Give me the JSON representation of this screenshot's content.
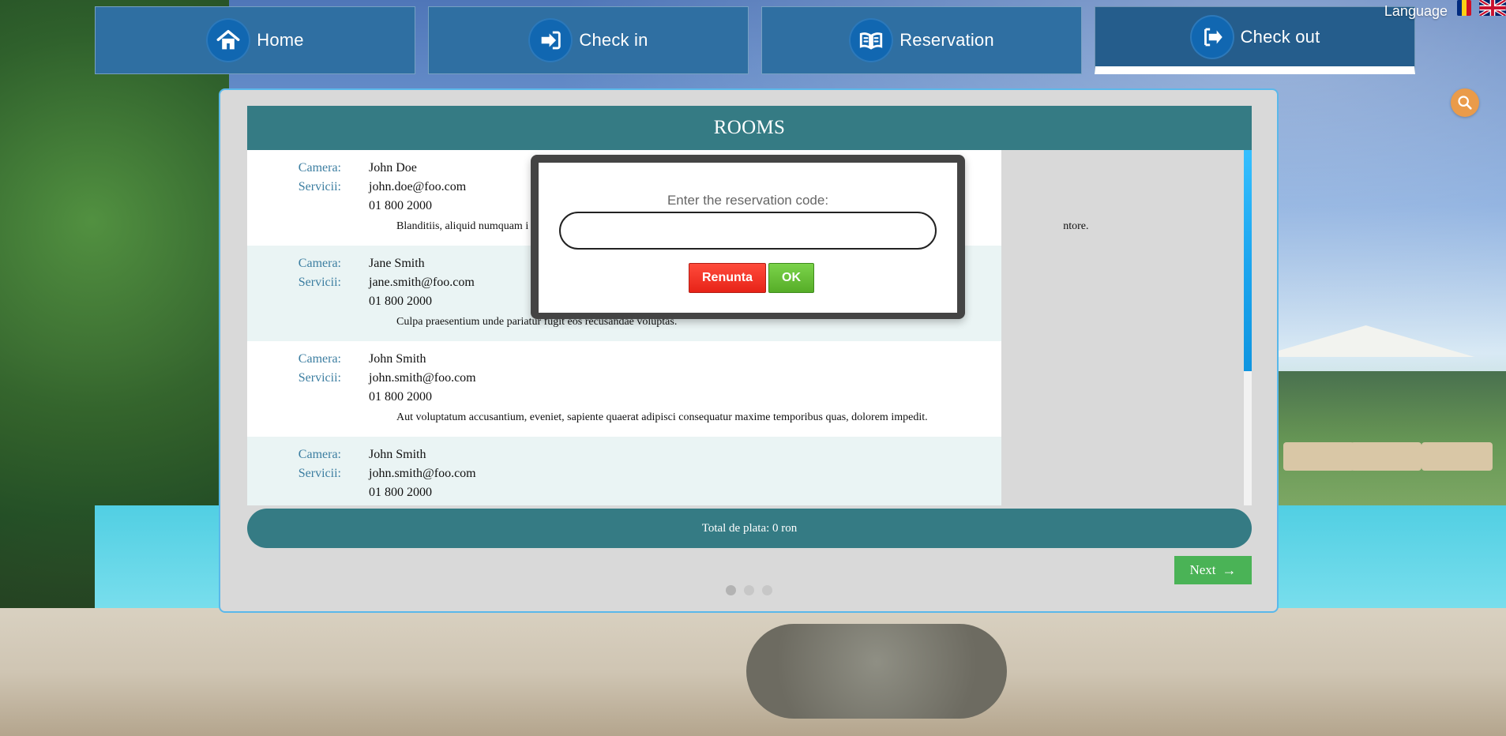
{
  "header": {
    "language_label": "Language",
    "nav": [
      {
        "label": "Home",
        "icon": "home-icon"
      },
      {
        "label": "Check in",
        "icon": "sign-in-icon"
      },
      {
        "label": "Reservation",
        "icon": "book-open-icon"
      },
      {
        "label": "Check out",
        "icon": "sign-out-icon",
        "active": true
      }
    ],
    "flags": [
      {
        "label": "Romanian flag",
        "icon": "romania-flag-icon"
      },
      {
        "label": "UK flag",
        "icon": "uk-flag-icon"
      }
    ],
    "search_icon": "search-icon"
  },
  "rooms_panel": {
    "title": "ROOMS",
    "labels": {
      "camera": "Camera:",
      "services": "Servicii:"
    },
    "entries": [
      {
        "name": "John Doe",
        "email": "john.doe@foo.com",
        "phone": "01 800 2000",
        "note": "Blanditiis, aliquid numquam i",
        "note_tail": "ntore."
      },
      {
        "name": "Jane Smith",
        "email": "jane.smith@foo.com",
        "phone": "01 800 2000",
        "note": "Culpa praesentium unde pariatur fugit eos recusandae voluptas."
      },
      {
        "name": "John Smith",
        "email": "john.smith@foo.com",
        "phone": "01 800 2000",
        "note": "Aut voluptatum accusantium, eveniet, sapiente quaerat adipisci consequatur maxime temporibus quas, dolorem impedit."
      },
      {
        "name": "John Smith",
        "email": "john.smith@foo.com",
        "phone": "01 800 2000"
      }
    ],
    "total_label": "Total de plata: 0 ron",
    "next_label": "Next",
    "next_arrow": "→",
    "pagination_dots": 3,
    "active_dot": 1
  },
  "modal": {
    "title": "Enter the reservation code:",
    "input_value": "",
    "cancel_label": "Renunta",
    "ok_label": "OK"
  },
  "colors": {
    "nav_blue": "#2f6fa2",
    "teal": "#357b84",
    "accent_blue": "#5ab8ea",
    "next_green": "#4ab356",
    "cancel_red": "#e72318",
    "ok_green": "#56ad28"
  }
}
